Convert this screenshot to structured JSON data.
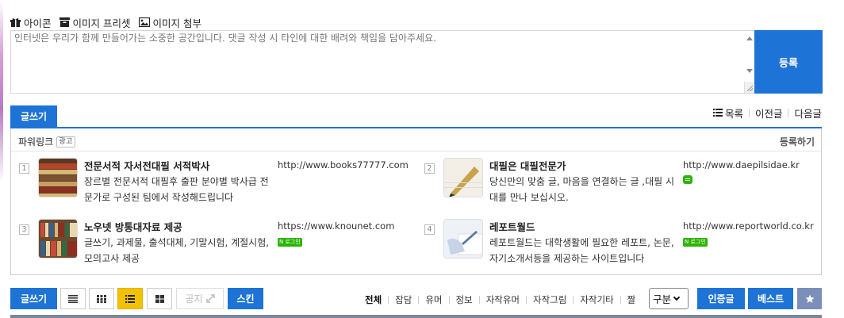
{
  "comment_tools": {
    "icon_label": "아이콘",
    "preset_label": "이미지 프리셋",
    "attach_label": "이미지 첨부"
  },
  "comment": {
    "placeholder": "인터넷은 우리가 함께 만들어가는 소중한 공간입니다. 댓글 작성 시 타인에 대한 배려와 책임을 담아주세요.",
    "submit_label": "등록"
  },
  "board_nav": {
    "write_label": "글쓰기",
    "list_label": "목록",
    "prev_label": "이전글",
    "next_label": "다음글"
  },
  "powerlink": {
    "title": "파워링크",
    "ad_tag": "광고",
    "register_label": "등록하기",
    "ads": [
      {
        "num": "1",
        "title": "전문서적 자서전대필 서적박사",
        "desc": "장르별 전문서적 대필후 출판 분야별 박사급 전문가로 구성된 팀에서 작성해드립니다",
        "url": "http://www.books77777.com",
        "badge": ""
      },
      {
        "num": "2",
        "title": "대필은 대필전문가",
        "desc": "당신만의 맞춤 글, 마음을 연결하는 글 ,대필 시대를 만나 보십시오.",
        "url": "http://www.daepilsidae.kr",
        "badge": "talk"
      },
      {
        "num": "3",
        "title": "노우넷 방통대자료 제공",
        "desc": "글쓰기, 과제물, 출석대체, 기말시험, 계절시험, 모의고사 제공",
        "url": "https://www.knounet.com",
        "badge": "로그인"
      },
      {
        "num": "4",
        "title": "레포트월드",
        "desc": "레포트월드는 대학생활에 필요한 레포트, 논문, 자기소개서등을 제공하는 사이트입니다",
        "url": "http://www.reportworld.co.kr",
        "badge": "로그인"
      }
    ]
  },
  "bottom_bar": {
    "write_label": "글쓰기",
    "notice_label": "공지",
    "skin_label": "스킨",
    "categories": [
      "전체",
      "잡담",
      "유머",
      "정보",
      "자작유머",
      "자작그림",
      "자작기타",
      "짤"
    ],
    "active_category": "전체",
    "sort_value": "구분",
    "certified_label": "인증글",
    "best_label": "베스트"
  },
  "colors": {
    "accent_blue": "#1e73d6",
    "active_view_yellow": "#f2c100",
    "naver_green": "#2db400",
    "star_button": "#7b8fb8"
  }
}
